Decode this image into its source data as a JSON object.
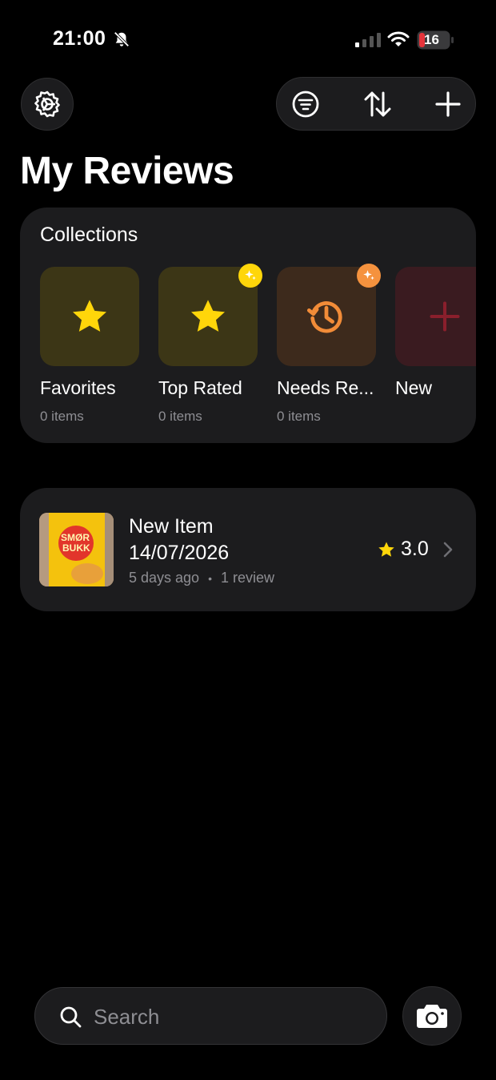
{
  "status_bar": {
    "time": "21:00",
    "battery": "16"
  },
  "header": {
    "title": "My Reviews"
  },
  "collections": {
    "heading": "Collections",
    "items": [
      {
        "name": "Favorites",
        "count": "0 items",
        "icon": "star-icon",
        "tile_color": "#3c3616",
        "icon_color": "#ffd60a"
      },
      {
        "name": "Top Rated",
        "count": "0 items",
        "icon": "star-icon",
        "tile_color": "#3c3616",
        "icon_color": "#ffd60a",
        "badge_color": "#ffd60a"
      },
      {
        "name": "Needs Re...",
        "count": "0 items",
        "icon": "history-icon",
        "tile_color": "#3d2a1c",
        "icon_color": "#f28c38",
        "badge_color": "#f5923e"
      },
      {
        "name": "New",
        "count": "",
        "icon": "plus-icon",
        "tile_color": "#3a1b20",
        "icon_color": "#8a1f2c"
      }
    ]
  },
  "items": [
    {
      "title_line1": "New Item",
      "title_line2": "14/07/2026",
      "time_ago": "5 days ago",
      "separator": "•",
      "reviews": "1 review",
      "rating": "3.0",
      "thumb_label_1": "SMØR",
      "thumb_label_2": "BUKK"
    }
  ],
  "search": {
    "placeholder": "Search"
  },
  "icons": {
    "settings": "gear-icon",
    "filter": "filter-icon",
    "sort": "sort-arrows-icon",
    "add": "plus-icon",
    "search": "search-icon",
    "camera": "camera-icon"
  }
}
